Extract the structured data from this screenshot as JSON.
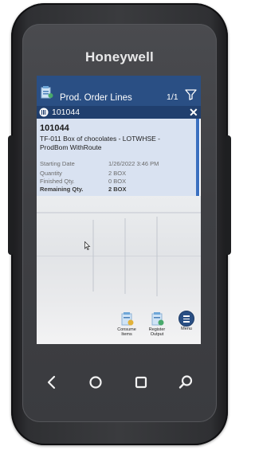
{
  "device": {
    "brand": "Honeywell"
  },
  "app": {
    "title": "Prod. Order Lines",
    "pager": "1/1",
    "record_number": "101044"
  },
  "card": {
    "order_no": "101044",
    "description": "TF-011  Box of chocolates - LOTWHSE - ProdBom WithRoute",
    "fields": [
      {
        "label": "Starting Date",
        "value": "1/26/2022 3:46 PM"
      },
      {
        "label": "Quantity",
        "value": "2 BOX"
      },
      {
        "label": "Finished Qty.",
        "value": "0 BOX"
      },
      {
        "label": "Remaining Qty.",
        "value": "2 BOX"
      }
    ]
  },
  "actions": {
    "consume_label_1": "Consume",
    "consume_label_2": "Items",
    "register_label_1": "Register",
    "register_label_2": "Output",
    "menu_label": "Menu"
  },
  "icons": {
    "filter": "filter-icon",
    "close": "close-icon",
    "barcode": "barcode-icon",
    "back": "back-icon",
    "home": "home-icon",
    "recents": "recents-icon",
    "search": "search-icon"
  },
  "colors": {
    "titlebar": "#2a4f84",
    "recordbar": "#203f6e",
    "card_bg": "#d9e2f1",
    "card_accent": "#3b70c0"
  }
}
